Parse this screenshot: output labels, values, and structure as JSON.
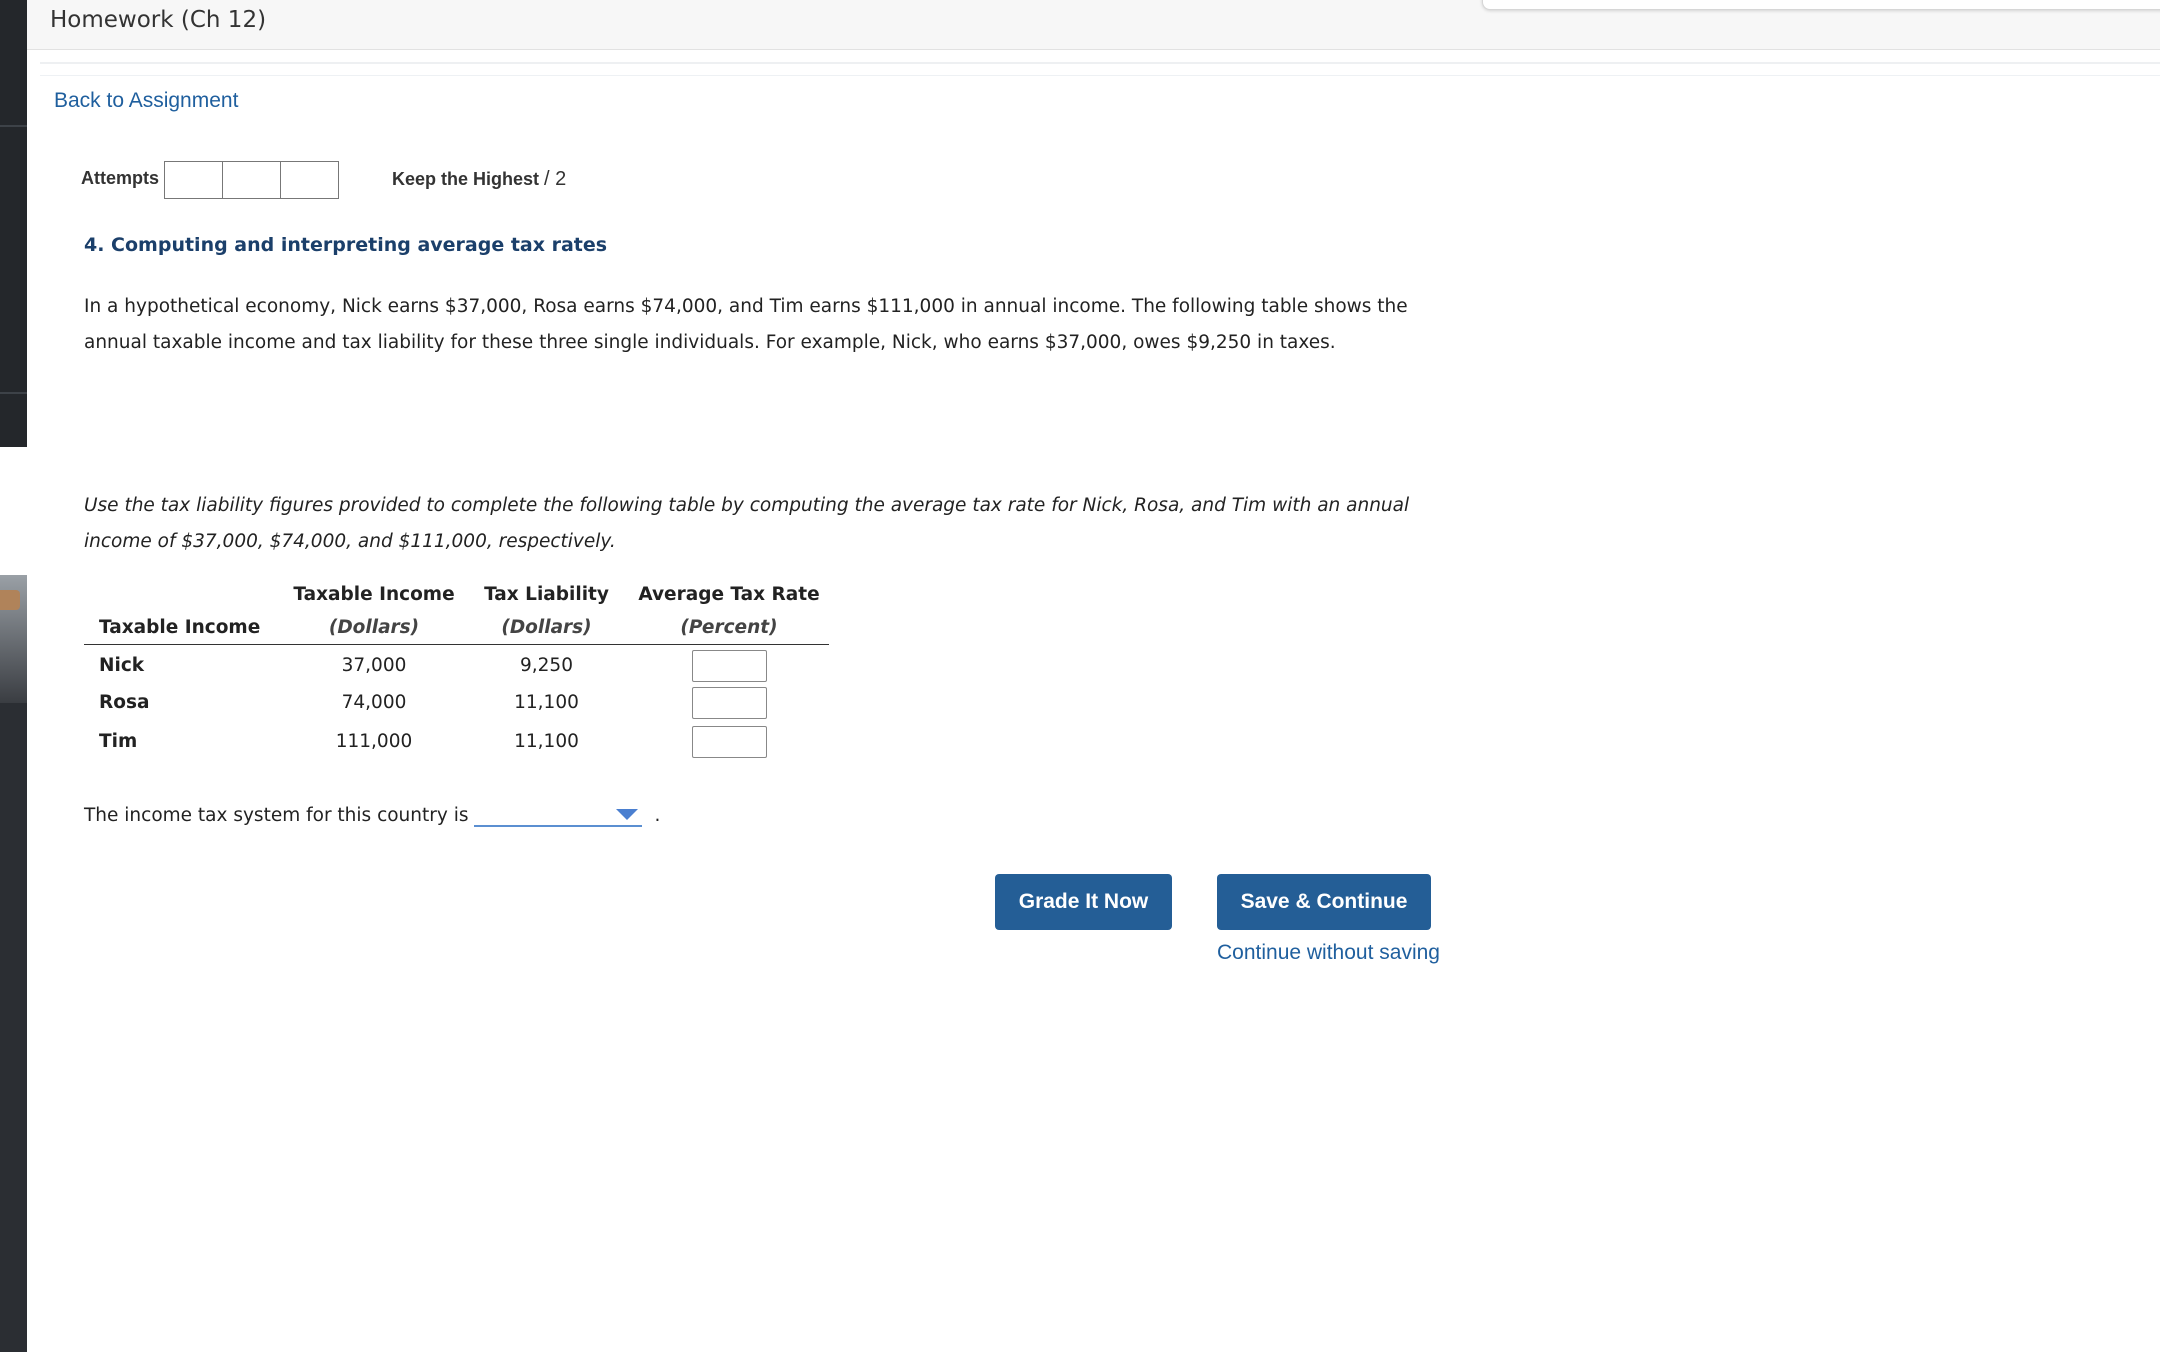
{
  "header": {
    "title": "Homework (Ch 12)"
  },
  "nav": {
    "back_label": "Back to Assignment"
  },
  "attempts": {
    "label": "Attempts",
    "keep_label": "Keep the Highest",
    "keep_value": "/ 2"
  },
  "question": {
    "title": "4. Computing and interpreting average tax rates",
    "intro": "In a hypothetical economy, Nick earns $37,000, Rosa earns $74,000, and Tim earns $111,000 in annual income. The following table shows the annual taxable income and tax liability for these three single individuals. For example, Nick, who earns $37,000, owes $9,250 in taxes.",
    "instructions": "Use the tax liability figures provided to complete the following table by computing the average tax rate for Nick, Rosa, and Tim with an annual income of $37,000, $74,000, and $111,000, respectively."
  },
  "table": {
    "headers": {
      "col0": "Taxable Income",
      "col1": "Taxable Income",
      "col1_unit": "(Dollars)",
      "col2": "Tax Liability",
      "col2_unit": "(Dollars)",
      "col3": "Average Tax Rate",
      "col3_unit": "(Percent)"
    },
    "rows": [
      {
        "name": "Nick",
        "income": "37,000",
        "liability": "9,250",
        "rate": ""
      },
      {
        "name": "Rosa",
        "income": "74,000",
        "liability": "11,100",
        "rate": ""
      },
      {
        "name": "Tim",
        "income": "111,000",
        "liability": "11,100",
        "rate": ""
      }
    ]
  },
  "conclusion": {
    "text": "The income tax system for this country is",
    "selected": "",
    "period": "."
  },
  "actions": {
    "grade_label": "Grade It Now",
    "save_label": "Save & Continue",
    "continue_label": "Continue without saving"
  },
  "colors": {
    "link": "#1f5f9e",
    "button": "#245e96",
    "title": "#1b3f6a"
  }
}
